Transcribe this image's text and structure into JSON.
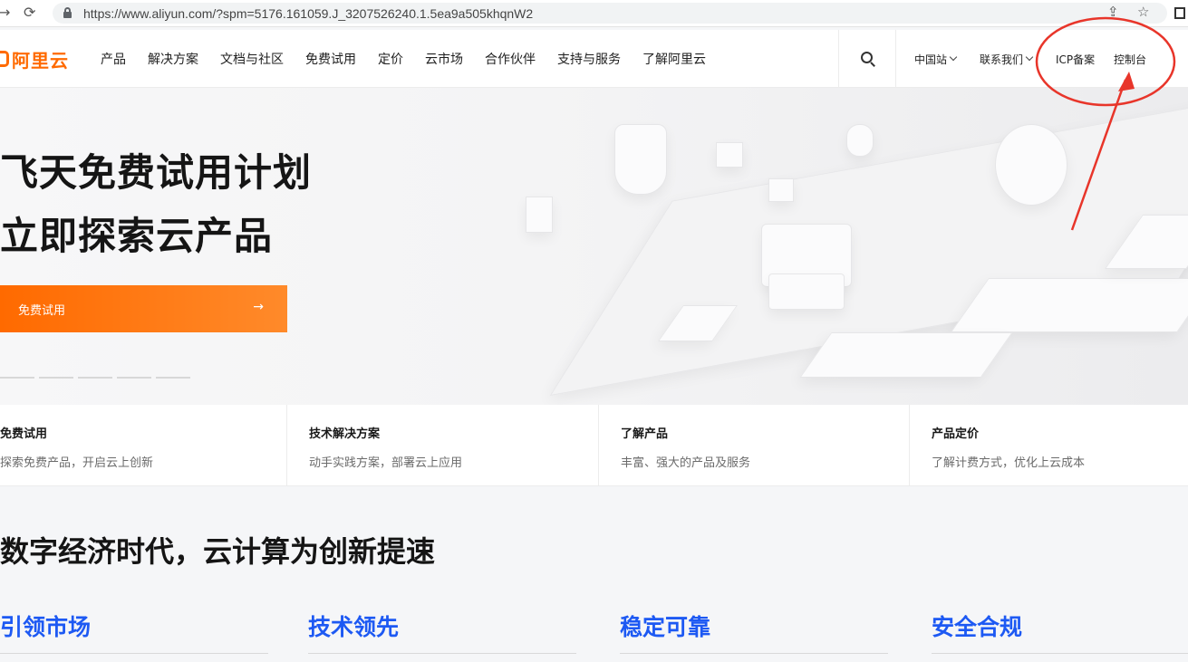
{
  "browser": {
    "back_icon": "arrow-left-icon",
    "reload_icon": "reload-icon",
    "url": "https://www.aliyun.com/?spm=5176.161059.J_3207526240.1.5ea9a505khqnW2",
    "share_icon": "share-icon",
    "star_icon": "star-icon"
  },
  "header": {
    "logo_text": "阿里云",
    "nav": [
      "产品",
      "解决方案",
      "文档与社区",
      "免费试用",
      "定价",
      "云市场",
      "合作伙伴",
      "支持与服务",
      "了解阿里云"
    ],
    "site_select": "中国站",
    "contact": "联系我们",
    "icp": "ICP备案",
    "console": "控制台"
  },
  "hero": {
    "title_line1": "飞天免费试用计划",
    "title_line2": "立即探索云产品",
    "cta_label": "免费试用",
    "cta_arrow": "→",
    "slide_count": 5,
    "active_slide": 1
  },
  "quick_links": [
    {
      "title": "免费试用",
      "desc": "探索免费产品，开启云上创新"
    },
    {
      "title": "技术解决方案",
      "desc": "动手实践方案，部署云上应用"
    },
    {
      "title": "了解产品",
      "desc": "丰富、强大的产品及服务"
    },
    {
      "title": "产品定价",
      "desc": "了解计费方式，优化上云成本"
    }
  ],
  "section": {
    "title": "数字经济时代，云计算为创新提速",
    "features": [
      "引领市场",
      "技术领先",
      "稳定可靠",
      "安全合规"
    ]
  },
  "colors": {
    "brand": "#ff6a00",
    "feature_blue": "#1d59f3",
    "annotation_red": "#e8352a"
  }
}
